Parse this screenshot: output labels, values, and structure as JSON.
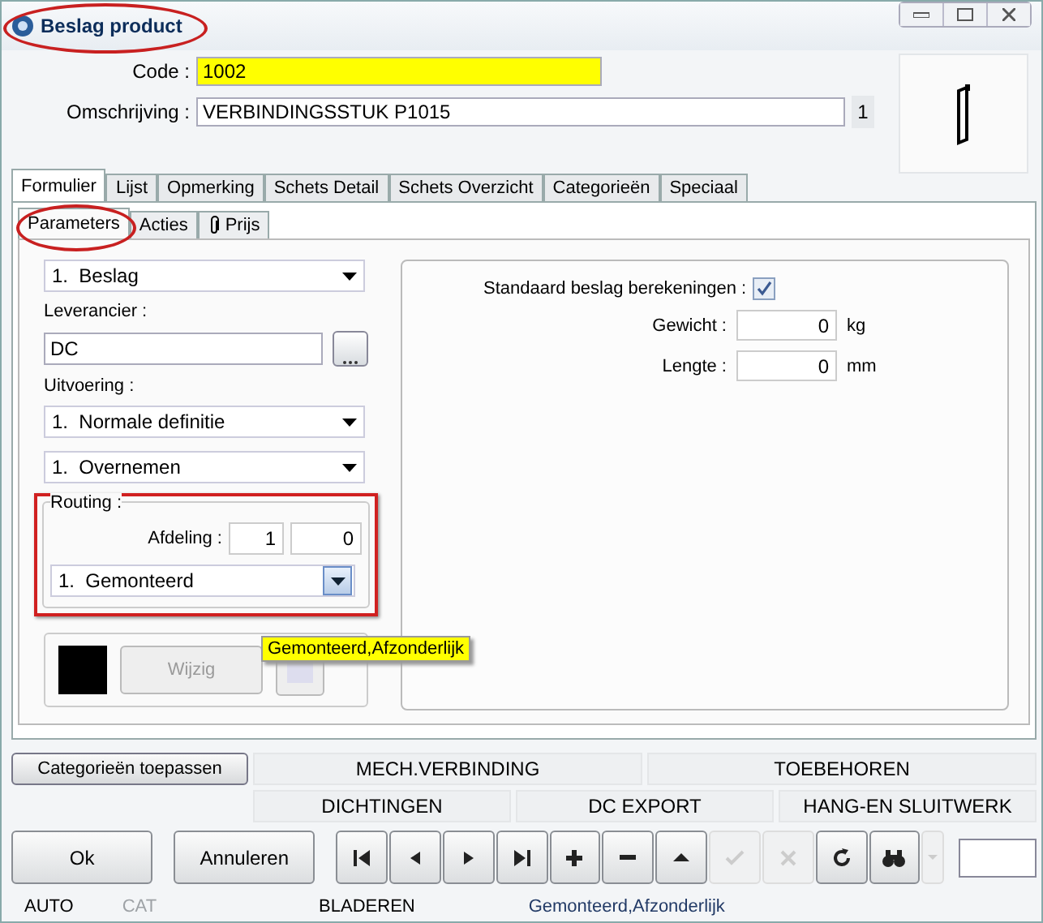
{
  "window": {
    "title": "Beslag product"
  },
  "header": {
    "code_label": "Code :",
    "code": "1002",
    "description_label": "Omschrijving :",
    "description": "VERBINDINGSSTUK P1015",
    "description_count": "1"
  },
  "tabs": [
    {
      "label": "Formulier",
      "selected": true
    },
    {
      "label": "Lijst",
      "selected": false
    },
    {
      "label": "Opmerking",
      "selected": false
    },
    {
      "label": "Schets Detail",
      "selected": false
    },
    {
      "label": "Schets Overzicht",
      "selected": false
    },
    {
      "label": "Categorieën",
      "selected": false
    },
    {
      "label": "Speciaal",
      "selected": false
    }
  ],
  "subtabs": [
    {
      "label": "Parameters",
      "selected": true,
      "kind": "text"
    },
    {
      "label": "Acties",
      "selected": false,
      "kind": "text"
    },
    {
      "label": "Prijs",
      "selected": false,
      "kind": "attachment"
    }
  ],
  "left": {
    "type_select": "1.  Beslag",
    "supplier_label": "Leverancier :",
    "supplier": "DC",
    "execution_label": "Uitvoering :",
    "execution_select": "1.  Normale definitie",
    "takeover_select": "1.  Overnemen",
    "routing": {
      "legend": "Routing :",
      "dept_label": "Afdeling :",
      "dept_1": "1",
      "dept_2": "0",
      "select": "1.  Gemonteerd"
    },
    "color_button": {
      "label": "Wijzig",
      "disabled": true
    }
  },
  "tooltip": "Gemonteerd,Afzonderlijk",
  "right": {
    "standard_label": "Standaard beslag berekeningen :",
    "standard_checked": true,
    "fields": [
      {
        "label": "Gewicht :",
        "value": "0",
        "unit": "kg"
      },
      {
        "label": "Lengte :",
        "value": "0",
        "unit": "mm"
      }
    ]
  },
  "category_button": "Categorieën toepassen",
  "category_rows": [
    [
      "MECH.VERBINDING",
      "TOEBEHOREN"
    ],
    [
      "DICHTINGEN",
      "DC EXPORT",
      "HANG-EN SLUITWERK"
    ]
  ],
  "toolbar": {
    "ok": "Ok",
    "cancel": "Annuleren",
    "buttons": [
      {
        "kind": "first",
        "disabled": false
      },
      {
        "kind": "prev",
        "disabled": false
      },
      {
        "kind": "next",
        "disabled": false
      },
      {
        "kind": "last",
        "disabled": false
      },
      {
        "kind": "add",
        "disabled": false
      },
      {
        "kind": "remove",
        "disabled": false
      },
      {
        "kind": "up",
        "disabled": false
      },
      {
        "kind": "confirm",
        "disabled": true
      },
      {
        "kind": "discard",
        "disabled": true
      },
      {
        "kind": "refresh",
        "disabled": false
      },
      {
        "kind": "search",
        "disabled": false
      },
      {
        "kind": "dropdown",
        "disabled": true
      }
    ]
  },
  "status": [
    {
      "text": "AUTO",
      "disabled": false,
      "kind": "mode"
    },
    {
      "text": "CAT",
      "disabled": true,
      "kind": "mode"
    },
    {
      "text": "BLADEREN",
      "disabled": false,
      "kind": "mode"
    },
    {
      "text": "Gemonteerd,Afzonderlijk",
      "kind": "info"
    }
  ]
}
